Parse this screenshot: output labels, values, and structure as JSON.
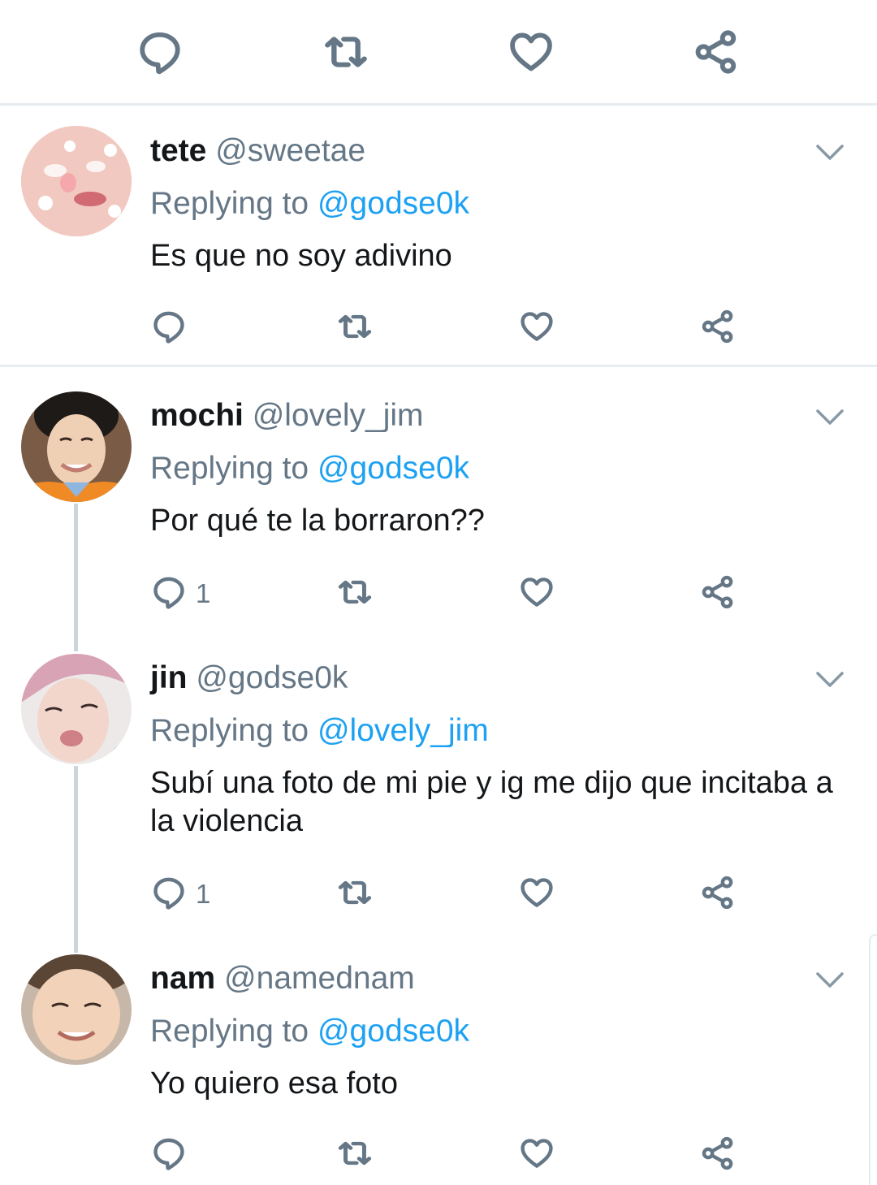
{
  "top_actions": {
    "reply_count": "",
    "retweet_count": "",
    "like_count": ""
  },
  "tweets": [
    {
      "name": "tete",
      "handle": "@sweetae",
      "replying_prefix": "Replying to",
      "replying_to": "@godse0k",
      "text": "Es que no soy adivino",
      "reply_count": ""
    },
    {
      "name": "mochi",
      "handle": "@lovely_jim",
      "replying_prefix": "Replying to",
      "replying_to": "@godse0k",
      "text": "Por qué te la borraron??",
      "reply_count": "1"
    },
    {
      "name": "jin",
      "handle": "@godse0k",
      "replying_prefix": "Replying to",
      "replying_to": "@lovely_jim",
      "text": "Subí una foto de mi pie y ig me dijo que incitaba a la violencia",
      "reply_count": "1"
    },
    {
      "name": "nam",
      "handle": "@namednam",
      "replying_prefix": "Replying to",
      "replying_to": "@godse0k",
      "text": "Yo quiero esa foto",
      "reply_count": ""
    }
  ],
  "icons": {
    "reply": "reply-bubble-icon",
    "retweet": "retweet-icon",
    "like": "heart-icon",
    "share": "share-icon",
    "menu": "chevron-down-icon"
  },
  "colors": {
    "text": "#14171a",
    "secondary": "#657786",
    "link": "#1da1f2",
    "divider": "#e6ecf0",
    "thread_line": "#ccd6dd"
  }
}
